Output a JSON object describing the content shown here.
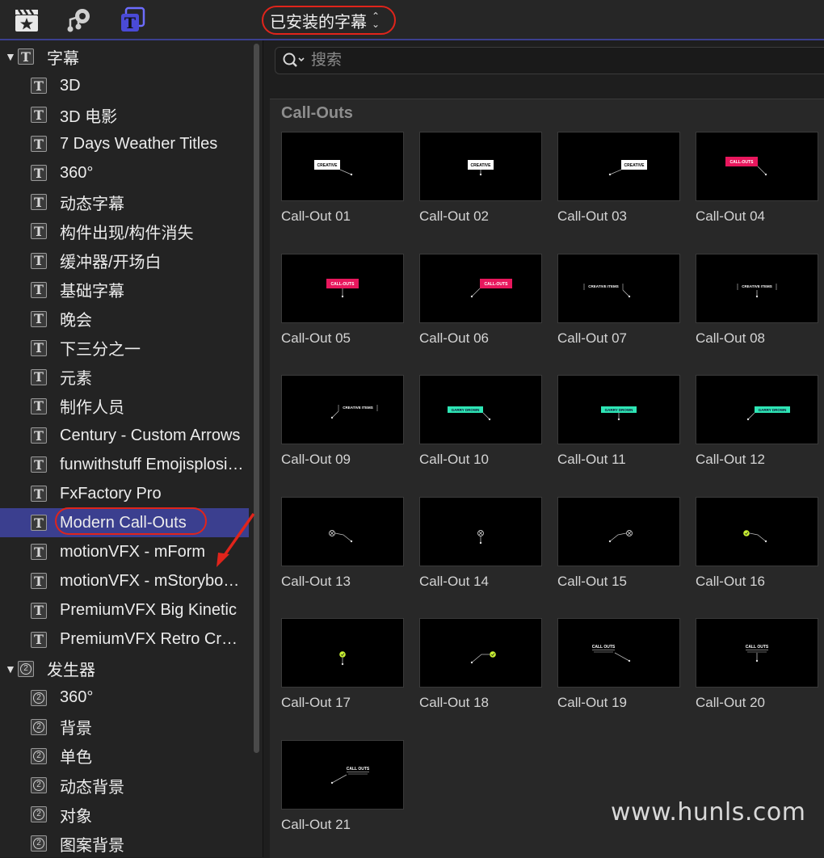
{
  "toolbar": {
    "icons": [
      "clapper-star-icon",
      "music-camera-icon",
      "titles-icon"
    ],
    "library_selector": "已安装的字幕",
    "selector_icon": "updown-chevron-icon",
    "accent_color": "#3b3f8f",
    "highlight_color": "#e0241b"
  },
  "sidebar": {
    "groups": [
      {
        "label": "字幕",
        "icon": "title-t-icon",
        "items": [
          "3D",
          "3D 电影",
          "7 Days Weather Titles",
          "360°",
          "动态字幕",
          "构件出现/构件消失",
          "缓冲器/开场白",
          "基础字幕",
          "晚会",
          "下三分之一",
          "元素",
          "制作人员",
          "Century - Custom Arrows",
          "funwithstuff Emojisplosion",
          "FxFactory Pro",
          "Modern Call-Outs",
          "motionVFX - mForm",
          "motionVFX - mStoryboard",
          "PremiumVFX Big Kinetic",
          "PremiumVFX Retro Credits"
        ]
      },
      {
        "label": "发生器",
        "icon": "generator-icon",
        "items": [
          "360°",
          "背景",
          "单色",
          "动态背景",
          "对象",
          "图案背景"
        ]
      }
    ],
    "selected": "Modern Call-Outs"
  },
  "search": {
    "placeholder": "搜索",
    "value": ""
  },
  "browser": {
    "section": "Call-Outs",
    "tiles": [
      {
        "name": "Call-Out 01",
        "style": "white-box",
        "text": "CREATIVE"
      },
      {
        "name": "Call-Out 02",
        "style": "white-box",
        "text": "CREATIVE"
      },
      {
        "name": "Call-Out 03",
        "style": "white-box",
        "text": "CREATIVE"
      },
      {
        "name": "Call-Out 04",
        "style": "pink-box",
        "text": "CALL-OUTS"
      },
      {
        "name": "Call-Out 05",
        "style": "pink-box",
        "text": "CALL-OUTS"
      },
      {
        "name": "Call-Out 06",
        "style": "pink-box",
        "text": "CALL-OUTS"
      },
      {
        "name": "Call-Out 07",
        "style": "outline",
        "text": "CREATIVE ITEMS"
      },
      {
        "name": "Call-Out 08",
        "style": "outline",
        "text": "CREATIVE ITEMS"
      },
      {
        "name": "Call-Out 09",
        "style": "outline",
        "text": "CREATIVE ITEMS"
      },
      {
        "name": "Call-Out 10",
        "style": "teal-box",
        "text": "GARRY DROWN"
      },
      {
        "name": "Call-Out 11",
        "style": "teal-box",
        "text": "GARRY DROWN"
      },
      {
        "name": "Call-Out 12",
        "style": "teal-box",
        "text": "GARRY DROWN"
      },
      {
        "name": "Call-Out 13",
        "style": "x-circle",
        "text": ""
      },
      {
        "name": "Call-Out 14",
        "style": "x-circle",
        "text": ""
      },
      {
        "name": "Call-Out 15",
        "style": "x-circle",
        "text": ""
      },
      {
        "name": "Call-Out 16",
        "style": "lime-dot",
        "text": ""
      },
      {
        "name": "Call-Out 17",
        "style": "lime-dot",
        "text": ""
      },
      {
        "name": "Call-Out 18",
        "style": "lime-dot",
        "text": ""
      },
      {
        "name": "Call-Out 19",
        "style": "plain",
        "text": "CALL OUTS"
      },
      {
        "name": "Call-Out 20",
        "style": "plain",
        "text": "CALL OUTS"
      },
      {
        "name": "Call-Out 21",
        "style": "plain",
        "text": "CALL OUTS"
      }
    ],
    "colors": {
      "pink": "#e8175d",
      "teal": "#2ee6b5",
      "lime": "#c8f032"
    }
  },
  "watermark": "www.hunls.com"
}
